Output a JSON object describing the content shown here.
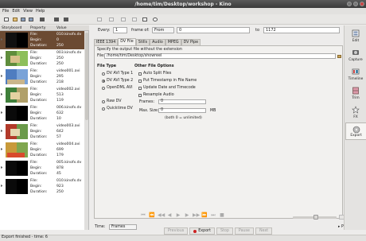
{
  "window": {
    "title": "/home/tim/Desktop/workshop - Kino"
  },
  "menu": [
    "File",
    "Edit",
    "View",
    "Help"
  ],
  "storyboard": {
    "headers": {
      "storyboard": "Storyboard",
      "property": "Property",
      "value": "Value"
    },
    "labels": {
      "file": "File:",
      "begin": "Begin:",
      "duration": "Duration:"
    },
    "clips": [
      {
        "file": "010.kinofx.dv",
        "begin": "0",
        "duration": "250",
        "selected": true
      },
      {
        "file": "003.kinofx.dv",
        "begin": "250",
        "duration": "250"
      },
      {
        "file": "video001.avi",
        "begin": "295",
        "duration": "218"
      },
      {
        "file": "video002.avi",
        "begin": "513",
        "duration": "119"
      },
      {
        "file": "006.kinofx.dv",
        "begin": "632",
        "duration": "10"
      },
      {
        "file": "video003.avi",
        "begin": "642",
        "duration": "57"
      },
      {
        "file": "video004.avi",
        "begin": "699",
        "duration": "179"
      },
      {
        "file": "005.kinofx.dv",
        "begin": "878",
        "duration": "45"
      },
      {
        "file": "010.kinofx.dv",
        "begin": "923",
        "duration": "250"
      }
    ]
  },
  "range": {
    "every_label": "Every:",
    "every_value": "1",
    "frame_of_label": "frame of:",
    "from_value": "From",
    "start_value": "0",
    "to_label": "to",
    "end_value": "1172"
  },
  "tabs": [
    "IEEE 1394",
    "DV File",
    "Stills",
    "Audio",
    "MPEG",
    "DV Pipe"
  ],
  "active_tab": "DV File",
  "dvfile": {
    "hint": "Specify the output file without the extension",
    "file_label": "File:",
    "file_value": "/home/tim/Desktop/showreel",
    "file_type_heading": "File Type",
    "other_options_heading": "Other File Options",
    "file_types": [
      {
        "label": "DV AVI Type 1",
        "checked": false
      },
      {
        "label": "DV AVI Type 2",
        "checked": true
      },
      {
        "label": "OpenDML AVI",
        "checked": false
      },
      {
        "label": "Raw DV",
        "checked": false
      },
      {
        "label": "Quicktime DV",
        "checked": false
      }
    ],
    "other_options": [
      {
        "label": "Auto Split Files",
        "checked": false
      },
      {
        "label": "Put Timestamp in File Name",
        "checked": false
      },
      {
        "label": "Update Date and Timecode",
        "checked": false
      },
      {
        "label": "Resample Audio",
        "checked": false
      }
    ],
    "frames_label": "Frames:",
    "frames_value": "0",
    "max_size_label": "Max. Size:",
    "max_size_value": "0",
    "max_size_unit": "MB",
    "unlimited_note": "(both 0 = unlimited)"
  },
  "actions": [
    {
      "label": "Previous",
      "enabled": false
    },
    {
      "label": "Export",
      "enabled": true
    },
    {
      "label": "Stop",
      "enabled": false
    },
    {
      "label": "Pause",
      "enabled": false
    },
    {
      "label": "Next",
      "enabled": false
    }
  ],
  "time": {
    "label": "Time:",
    "format": "Frames"
  },
  "properties_label": "Properties",
  "sidebar": [
    {
      "label": "Edit",
      "icon": "edit-icon"
    },
    {
      "label": "Capture",
      "icon": "capture-icon"
    },
    {
      "label": "Timeline",
      "icon": "timeline-icon"
    },
    {
      "label": "Trim",
      "icon": "trim-icon"
    },
    {
      "label": "FX",
      "icon": "fx-icon"
    },
    {
      "label": "Export",
      "icon": "export-icon",
      "active": true
    }
  ],
  "status": "Export finished - time: 6"
}
